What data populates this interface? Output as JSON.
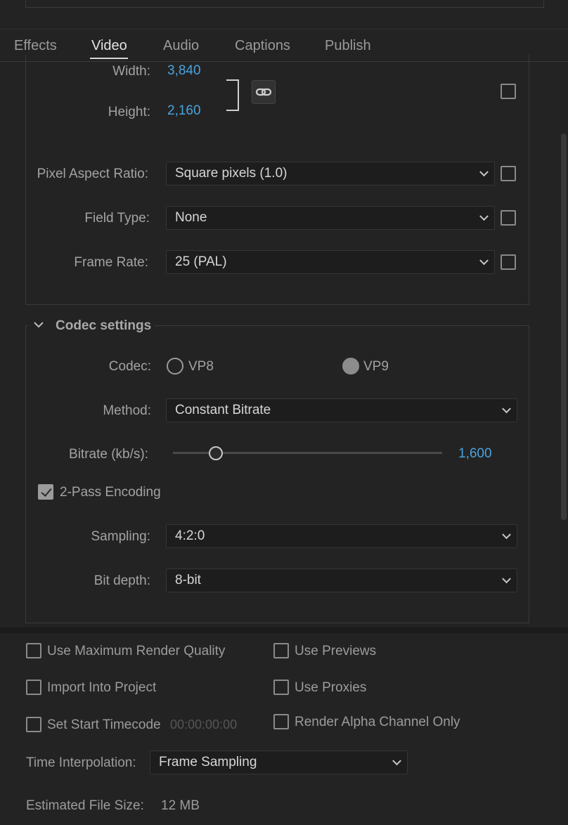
{
  "tabs": [
    {
      "label": "Effects"
    },
    {
      "label": "Video"
    },
    {
      "label": "Audio"
    },
    {
      "label": "Captions"
    },
    {
      "label": "Publish"
    }
  ],
  "video": {
    "width_label": "Width:",
    "width_value": "3,840",
    "height_label": "Height:",
    "height_value": "2,160",
    "link_icon": "link-icon",
    "pixel_aspect_label": "Pixel Aspect Ratio:",
    "pixel_aspect_value": "Square pixels (1.0)",
    "field_type_label": "Field Type:",
    "field_type_value": "None",
    "frame_rate_label": "Frame Rate:",
    "frame_rate_value": "25 (PAL)"
  },
  "codec_settings": {
    "title": "Codec settings",
    "codec_label": "Codec:",
    "codec_options": [
      {
        "label": "VP8",
        "selected": false
      },
      {
        "label": "VP9",
        "selected": true
      }
    ],
    "method_label": "Method:",
    "method_value": "Constant Bitrate",
    "bitrate_label": "Bitrate (kb/s):",
    "bitrate_value": "1,600",
    "bitrate_fraction": 0.16,
    "two_pass_label": "2-Pass Encoding",
    "two_pass_checked": true,
    "sampling_label": "Sampling:",
    "sampling_value": "4:2:0",
    "bit_depth_label": "Bit depth:",
    "bit_depth_value": "8-bit"
  },
  "footer": {
    "max_render_quality": "Use Maximum Render Quality",
    "use_previews": "Use Previews",
    "import_into_project": "Import Into Project",
    "use_proxies": "Use Proxies",
    "set_start_timecode": "Set Start Timecode",
    "start_timecode_value": "00:00:00:00",
    "render_alpha_only": "Render Alpha Channel Only",
    "time_interpolation_label": "Time Interpolation:",
    "time_interpolation_value": "Frame Sampling",
    "estimated_size_label": "Estimated File Size:",
    "estimated_size_value": "12 MB"
  },
  "colors": {
    "background": "#232323",
    "accent_blue": "#4aa3df"
  }
}
